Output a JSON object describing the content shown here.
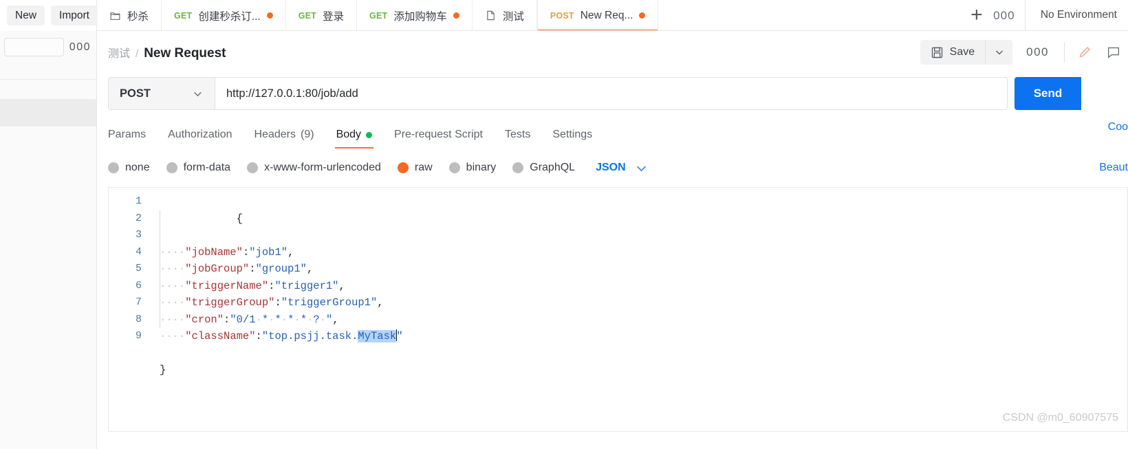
{
  "topbar": {
    "new_label": "New",
    "import_label": "Import",
    "tabs": [
      {
        "icon": "folder-icon",
        "verb": "",
        "name": "秒杀",
        "unsaved": false
      },
      {
        "icon": "",
        "verb": "GET",
        "name": "创建秒杀订...",
        "unsaved": true
      },
      {
        "icon": "",
        "verb": "GET",
        "name": "登录",
        "unsaved": false
      },
      {
        "icon": "",
        "verb": "GET",
        "name": "添加购物车",
        "unsaved": true
      },
      {
        "icon": "document-icon",
        "verb": "",
        "name": "测试",
        "unsaved": false
      },
      {
        "icon": "",
        "verb": "POST",
        "name": "New Req...",
        "unsaved": true
      }
    ],
    "selected_tab_index": 5,
    "add_tab_label": "+",
    "more_label": "000",
    "environment_label": "No Environment"
  },
  "sidebar": {
    "search_placeholder": "",
    "more_label": "000"
  },
  "request": {
    "breadcrumb_folder": "测试",
    "breadcrumb_separator": "/",
    "breadcrumb_title": "New Request",
    "save_label": "Save",
    "save_caret": "⌄",
    "more_label": "000",
    "edit_icon": "pencil-icon",
    "comment_icon": "comment-icon",
    "method": "POST",
    "method_caret": "⌄",
    "url": "http://127.0.0.1:80/job/add",
    "send_label": "Send",
    "tabs": [
      {
        "label": "Params",
        "count": "",
        "active": false,
        "dot": false
      },
      {
        "label": "Authorization",
        "count": "",
        "active": false,
        "dot": false
      },
      {
        "label": "Headers",
        "count": "(9)",
        "active": false,
        "dot": false
      },
      {
        "label": "Body",
        "count": "",
        "active": true,
        "dot": true
      },
      {
        "label": "Pre-request Script",
        "count": "",
        "active": false,
        "dot": false
      },
      {
        "label": "Tests",
        "count": "",
        "active": false,
        "dot": false
      },
      {
        "label": "Settings",
        "count": "",
        "active": false,
        "dot": false
      }
    ],
    "cookies_link": "Coo",
    "body_types": [
      {
        "label": "none",
        "selected": false
      },
      {
        "label": "form-data",
        "selected": false
      },
      {
        "label": "x-www-form-urlencoded",
        "selected": false
      },
      {
        "label": "raw",
        "selected": true
      },
      {
        "label": "binary",
        "selected": false
      },
      {
        "label": "GraphQL",
        "selected": false
      }
    ],
    "raw_format": "JSON",
    "raw_format_caret": "⌄",
    "beautify_link": "Beaut"
  },
  "editor": {
    "line_numbers": [
      "1",
      "2",
      "3",
      "4",
      "5",
      "6",
      "7",
      "8",
      "9"
    ],
    "lines": [
      {
        "n": 1,
        "text": "{"
      },
      {
        "n": 2,
        "key": "\"jobName\"",
        "value": "\"job1\"",
        "trail": ","
      },
      {
        "n": 3,
        "key": "\"jobGroup\"",
        "value": "\"group1\"",
        "trail": ","
      },
      {
        "n": 4,
        "key": "\"triggerName\"",
        "value": "\"trigger1\"",
        "trail": ","
      },
      {
        "n": 5,
        "key": "\"triggerGroup\"",
        "value": "\"triggerGroup1\"",
        "trail": ","
      },
      {
        "n": 6,
        "key": "\"cron\"",
        "value": "\"0/1 * * * * ? \"",
        "trail": ","
      },
      {
        "n": 7,
        "key": "\"className\"",
        "value": "\"top.psjj.task.MyTask\"",
        "trail": "",
        "selection": "MyTask"
      },
      {
        "n": 8,
        "text": ""
      },
      {
        "n": 9,
        "text": "}"
      }
    ],
    "raw_json_text": "{\n    \"jobName\":\"job1\",\n    \"jobGroup\":\"group1\",\n    \"triggerName\":\"trigger1\",\n    \"triggerGroup\":\"triggerGroup1\",\n    \"cron\":\"0/1 * * * * ? \",\n    \"className\":\"top.psjj.task.MyTask\"\n\n}",
    "selected_text": "MyTask"
  },
  "watermark": "CSDN @m0_60907575",
  "colors": {
    "accent_orange": "#ff6c37",
    "send_blue": "#0c72f0",
    "link_blue": "#0c72f0",
    "unsaved_dot": "#f26b21",
    "body_dot_green": "#0cbb52",
    "get_green": "#6bb344",
    "post_orange": "#d9a33d",
    "json_key": "#a83535",
    "json_value": "#2760b5",
    "selection_bg": "#b3d4fc"
  }
}
